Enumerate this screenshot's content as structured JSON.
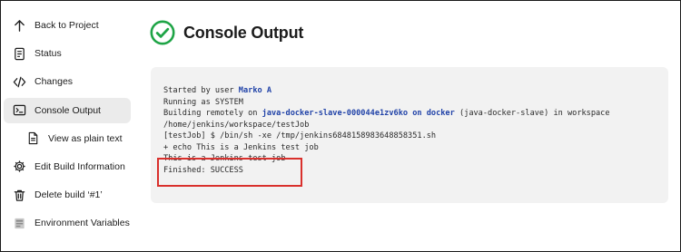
{
  "sidebar": {
    "items": [
      {
        "label": "Back to Project",
        "icon": "arrow-up-icon"
      },
      {
        "label": "Status",
        "icon": "document-icon"
      },
      {
        "label": "Changes",
        "icon": "code-icon"
      },
      {
        "label": "Console Output",
        "icon": "terminal-icon",
        "active": true
      },
      {
        "label": "View as plain text",
        "icon": "file-icon"
      },
      {
        "label": "Edit Build Information",
        "icon": "gear-icon"
      },
      {
        "label": "Delete build ‘#1’",
        "icon": "trash-icon"
      },
      {
        "label": "Environment Variables",
        "icon": "env-vars-icon"
      }
    ]
  },
  "header": {
    "title": "Console Output",
    "status_icon": "success-check-icon",
    "status_color": "#1ea446"
  },
  "console": {
    "line1_prefix": "Started by user ",
    "line1_user": "Marko A",
    "line2": "Running as SYSTEM",
    "line3_prefix": "Building remotely on ",
    "line3_node": "java-docker-slave-000044e1zv6ko on docker",
    "line3_suffix": " (java-docker-slave) in workspace",
    "line4": "/home/jenkins/workspace/testJob",
    "line5": "[testJob] $ /bin/sh -xe /tmp/jenkins6848158983648858351.sh",
    "line6": "+ echo This is a Jenkins test job",
    "line7": "This is a Jenkins test job",
    "line8": "Finished: SUCCESS",
    "link_color": "#2143a8",
    "highlight_color": "#d9302c"
  }
}
